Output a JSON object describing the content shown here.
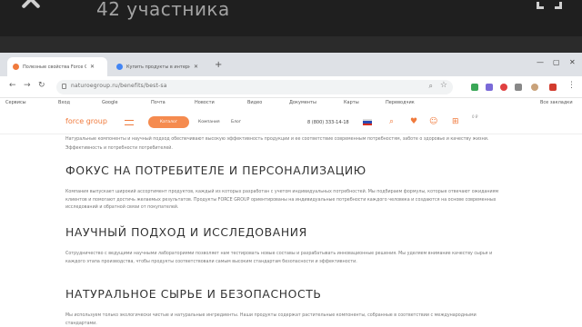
{
  "telegram": {
    "title": "42 участника"
  },
  "browser": {
    "tabs": [
      {
        "label": "Полезные свойства Force Group",
        "active": true,
        "icon": "orange-favicon"
      },
      {
        "label": "Купить продукты в интернет",
        "active": false,
        "icon": "google-favicon"
      }
    ],
    "new_tab": "+",
    "url": "naturoegroup.ru/benefits/best-sa",
    "window_controls": {
      "minimize": "—",
      "maximize": "▢",
      "close": "✕"
    },
    "bookmarks": [
      "Сервисы",
      "Вход",
      "Google",
      "Почта",
      "Новости",
      "Видео",
      "Документы",
      "Карты",
      "Переводчик",
      "Все закладки"
    ]
  },
  "site": {
    "logo": "force group",
    "catalog_button": "Каталог",
    "links": [
      "Компания",
      "Блог"
    ],
    "phone": "8 (800) 333-14-18",
    "cart_sum": "0 ₽",
    "colors": {
      "accent": "#f07a3c",
      "button": "#f58b4f"
    }
  },
  "article": {
    "intro": "Натуральные компоненты и научный подход обеспечивают высокую эффективность продукции и ее соответствие современным потребностям, заботе о здоровье и качеству жизни.",
    "intro2": "Эффективность и потребности потребителей.",
    "sections": [
      {
        "heading": "ФОКУС НА ПОТРЕБИТЕЛЕ И ПЕРСОНАЛИЗАЦИЮ",
        "text": "Компания выпускает широкий ассортимент продуктов, каждый из которых разработан с учетом индивидуальных потребностей. Мы подбираем формулы, которые отвечают ожиданиям клиентов и помогают достичь желаемых результатов. Продукты FORCE GROUP ориентированы на индивидуальные потребности каждого человека и создаются на основе современных исследований и обратной связи от покупателей."
      },
      {
        "heading": "НАУЧНЫЙ ПОДХОД И ИССЛЕДОВАНИЯ",
        "text": "Сотрудничество с ведущими научными лабораториями позволяет нам тестировать новые составы и разрабатывать инновационные решения. Мы уделяем внимание качеству сырья и каждого этапа производства, чтобы продукты соответствовали самым высоким стандартам безопасности и эффективности."
      },
      {
        "heading": "НАТУРАЛЬНОЕ СЫРЬЕ И БЕЗОПАСНОСТЬ",
        "text": "Мы используем только экологически чистые и натуральные ингредиенты. Наши продукты содержат растительные компоненты, собранные в соответствии с международными стандартами."
      }
    ]
  }
}
